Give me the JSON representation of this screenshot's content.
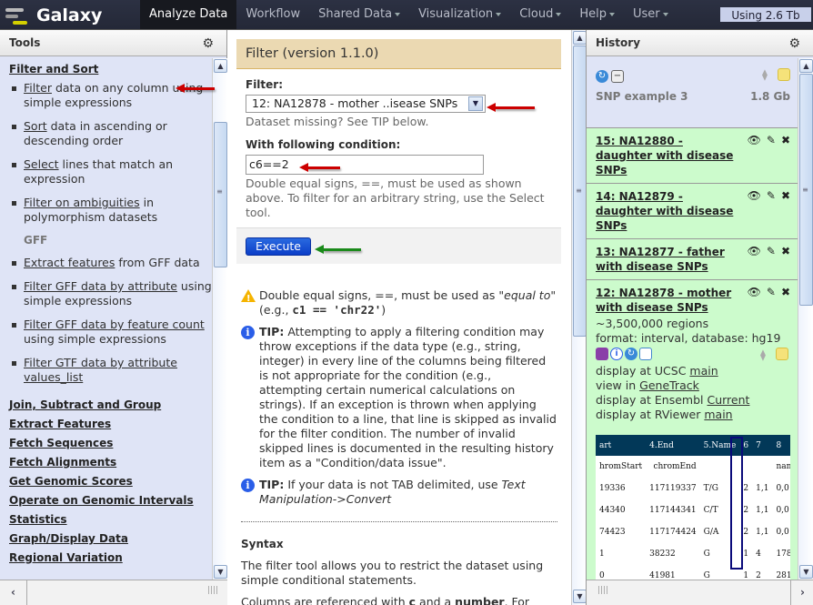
{
  "masthead": {
    "brand": "Galaxy",
    "tabs": [
      {
        "label": "Analyze Data",
        "active": true,
        "dropdown": false
      },
      {
        "label": "Workflow",
        "active": false,
        "dropdown": false
      },
      {
        "label": "Shared Data",
        "active": false,
        "dropdown": true
      },
      {
        "label": "Visualization",
        "active": false,
        "dropdown": true
      },
      {
        "label": "Cloud",
        "active": false,
        "dropdown": true
      },
      {
        "label": "Help",
        "active": false,
        "dropdown": true
      },
      {
        "label": "User",
        "active": false,
        "dropdown": true
      }
    ],
    "quota": "Using 2.6 Tb"
  },
  "tools": {
    "header": "Tools",
    "current_section": "Filter and Sort",
    "items": [
      {
        "link": "Filter",
        "rest": " data on any column using simple expressions"
      },
      {
        "link": "Sort",
        "rest": " data in ascending or descending order"
      },
      {
        "link": "Select",
        "rest": " lines that match an expression"
      },
      {
        "link": "Filter on ambiguities",
        "rest": " in polymorphism datasets"
      }
    ],
    "gff_label": "GFF",
    "gff_items": [
      {
        "link": "Extract features",
        "rest": " from GFF data"
      },
      {
        "link": "Filter GFF data by attribute",
        "rest": " using simple expressions"
      },
      {
        "link": "Filter GFF data by feature count",
        "rest": " using simple expressions"
      },
      {
        "link": "Filter GTF data by attribute values_list",
        "rest": ""
      }
    ],
    "sections": [
      "Join, Subtract and Group",
      "Extract Features",
      "Fetch Sequences",
      "Fetch Alignments",
      "Get Genomic Scores",
      "Operate on Genomic Intervals",
      "Statistics",
      "Graph/Display Data",
      "Regional Variation"
    ]
  },
  "form": {
    "title": "Filter (version 1.1.0)",
    "filter_label": "Filter:",
    "filter_value": "12: NA12878 - mother ..isease SNPs",
    "filter_help": "Dataset missing? See TIP below.",
    "condition_label": "With following condition:",
    "condition_value": "c6==2",
    "condition_help": "Double equal signs, ==, must be used as shown above. To filter for an arbitrary string, use the Select tool.",
    "execute_label": "Execute"
  },
  "help": {
    "warning_pre": "Double equal signs, ==, must be used as ",
    "warning_em": "\"equal to\"",
    "warning_eg_pre": "(e.g., ",
    "warning_eg_code": "c1 == 'chr22'",
    "warning_eg_post": ")",
    "tip1_label": "TIP:",
    "tip1_text": " Attempting to apply a filtering condition may throw exceptions if the data type (e.g., string, integer) in every line of the columns being filtered is not appropriate for the condition (e.g., attempting certain numerical calculations on strings). If an exception is thrown when applying the condition to a line, that line is skipped as invalid for the filter condition. The number of invalid skipped lines is documented in the resulting history item as a \"Condition/data issue\".",
    "tip2_label": "TIP:",
    "tip2_text": " If your data is not TAB delimited, use ",
    "tip2_em": "Text Manipulation->Convert",
    "syntax_title": "Syntax",
    "syntax_text": "The filter tool allows you to restrict the dataset using simple conditional statements.",
    "syntax_more_pre": "Columns are referenced with ",
    "syntax_more_c": "c",
    "syntax_more_mid": " and a ",
    "syntax_more_num": "number",
    "syntax_more_post": ". For"
  },
  "history": {
    "header": "History",
    "name": "SNP example 3",
    "size": "1.8 Gb",
    "datasets": [
      {
        "title": "15: NA12880 - daughter with disease SNPs"
      },
      {
        "title": "14: NA12879 - daughter with disease SNPs"
      },
      {
        "title": "13: NA12877 - father with disease SNPs"
      },
      {
        "title": "12: NA12878 - mother with disease SNPs"
      }
    ],
    "expanded": {
      "regions": "~3,500,000 regions",
      "format": "format: interval, database: hg19",
      "links": [
        {
          "pre": "display at UCSC ",
          "link": "main"
        },
        {
          "pre": "view in ",
          "link": "GeneTrack"
        },
        {
          "pre": "display at Ensembl ",
          "link": "Current"
        },
        {
          "pre": "display at RViewer ",
          "link": "main"
        }
      ],
      "peek": {
        "headers": [
          "art",
          "4.End",
          "5.Name",
          "6",
          "7",
          "8"
        ],
        "subheaders": [
          "hromStart",
          "chromEnd",
          "",
          "",
          "",
          "name"
        ],
        "rows": [
          [
            "19336",
            "117119337",
            "T/G",
            "2",
            "1,1",
            "0,0"
          ],
          [
            "44340",
            "117144341",
            "C/T",
            "2",
            "1,1",
            "0,0"
          ],
          [
            "74423",
            "117174424",
            "G/A",
            "2",
            "1,1",
            "0,0"
          ],
          [
            "1",
            "38232",
            "G",
            "1",
            "4",
            "178"
          ],
          [
            "0",
            "41981",
            "G",
            "1",
            "2",
            "281"
          ]
        ]
      }
    }
  },
  "colors": {
    "masthead_bg": "#2c3143",
    "panel_bg": "#dfe4f6",
    "dataset_ok_bg": "#ccfbcc",
    "form_title_bg": "#ebd9b2",
    "execute_bg": "#1450d8",
    "peek_header_bg": "#023858",
    "annotation_red": "#cc0000",
    "annotation_green": "#1a8a1a"
  }
}
